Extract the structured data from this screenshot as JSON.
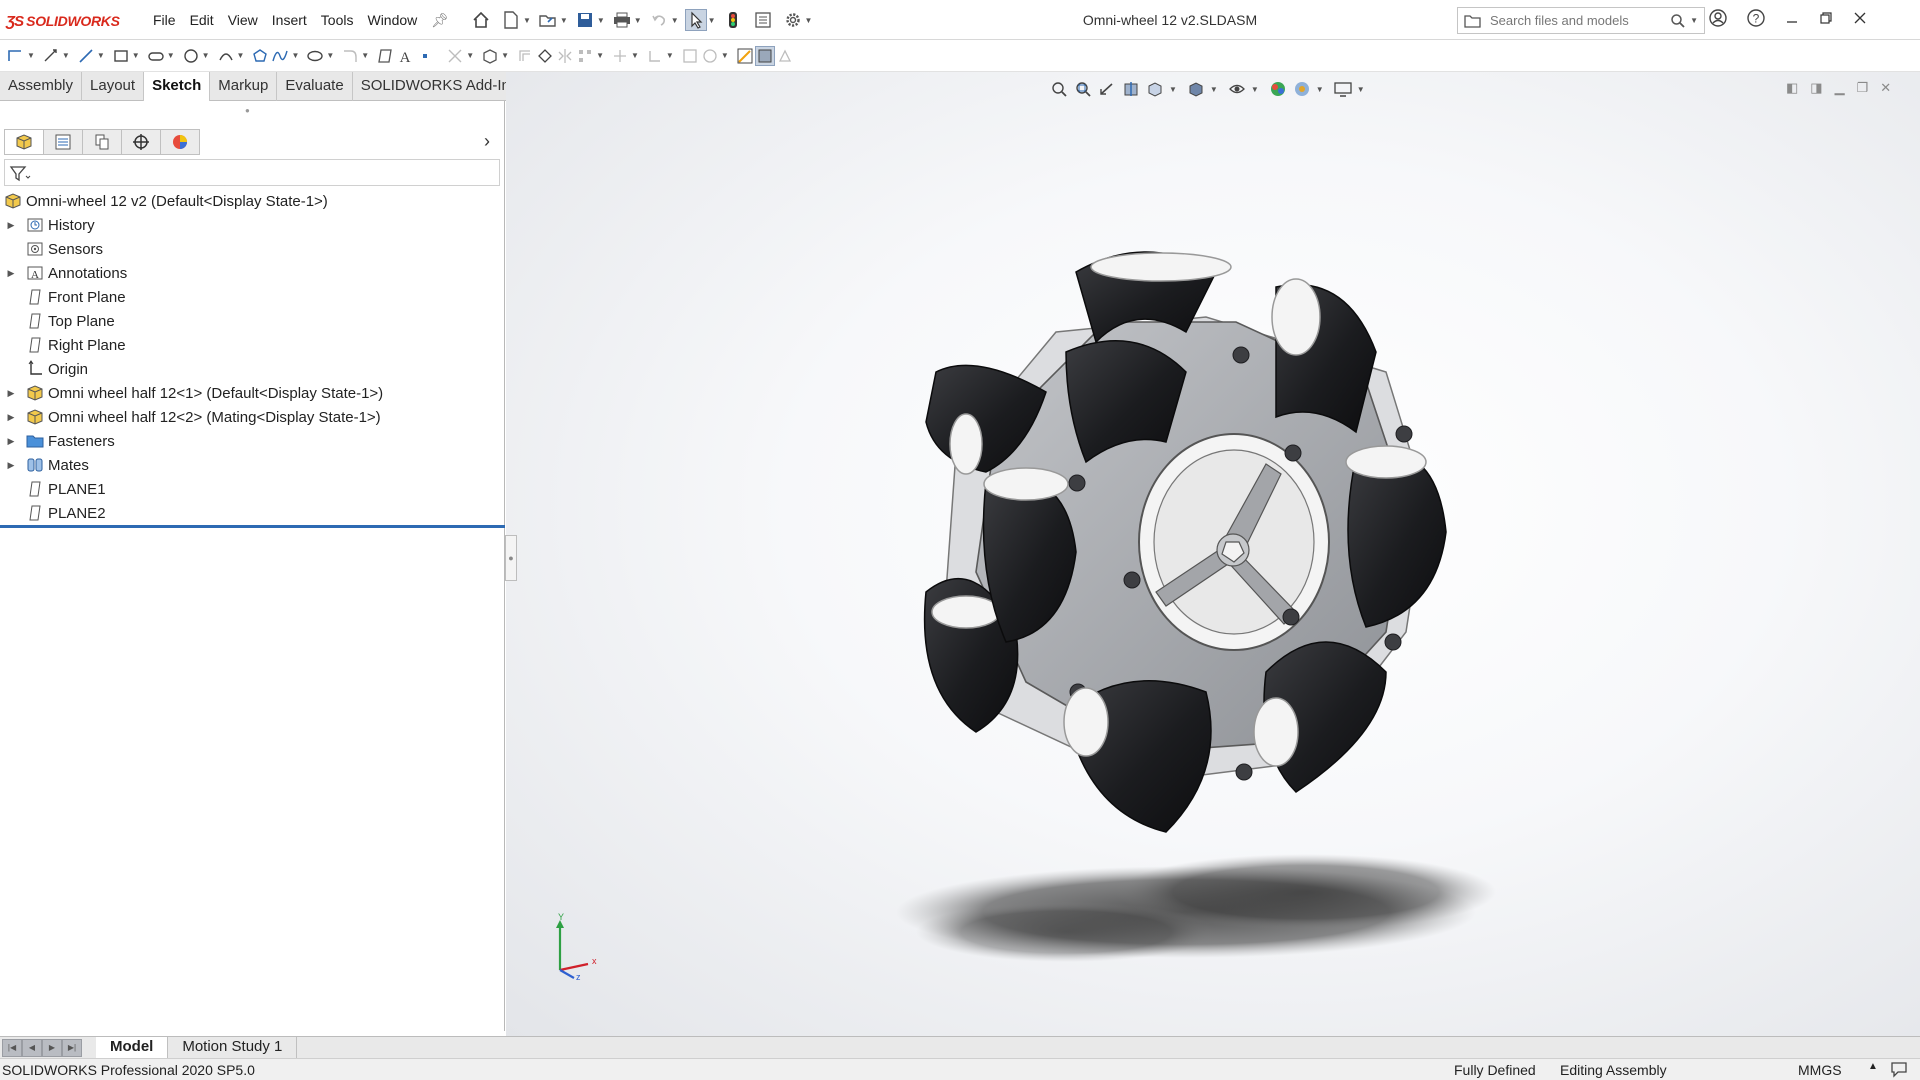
{
  "app": {
    "logo_ds": "ƷS",
    "logo_text": "SOLIDWORKS",
    "document_title": "Omni-wheel 12 v2.SLDASM"
  },
  "menu": [
    "File",
    "Edit",
    "View",
    "Insert",
    "Tools",
    "Window"
  ],
  "search": {
    "placeholder": "Search files and models"
  },
  "command_tabs": [
    {
      "label": "Assembly",
      "active": false
    },
    {
      "label": "Layout",
      "active": false
    },
    {
      "label": "Sketch",
      "active": true
    },
    {
      "label": "Markup",
      "active": false
    },
    {
      "label": "Evaluate",
      "active": false
    },
    {
      "label": "SOLIDWORKS Add-Ins",
      "active": false
    }
  ],
  "feature_tree": {
    "root": "Omni-wheel 12 v2  (Default<Display State-1>)",
    "items": [
      {
        "label": "History",
        "expandable": true,
        "icon": "history-icon"
      },
      {
        "label": "Sensors",
        "expandable": false,
        "icon": "sensor-icon"
      },
      {
        "label": "Annotations",
        "expandable": true,
        "icon": "annotation-icon"
      },
      {
        "label": "Front Plane",
        "expandable": false,
        "icon": "plane-icon"
      },
      {
        "label": "Top Plane",
        "expandable": false,
        "icon": "plane-icon"
      },
      {
        "label": "Right Plane",
        "expandable": false,
        "icon": "plane-icon"
      },
      {
        "label": "Origin",
        "expandable": false,
        "icon": "origin-icon"
      },
      {
        "label": "Omni wheel half 12<1> (Default<Display State-1>)",
        "expandable": true,
        "icon": "part-icon"
      },
      {
        "label": "Omni wheel half 12<2> (Mating<Display State-1>)",
        "expandable": true,
        "icon": "part-icon"
      },
      {
        "label": "Fasteners",
        "expandable": true,
        "icon": "folder-icon"
      },
      {
        "label": "Mates",
        "expandable": true,
        "icon": "mates-icon"
      },
      {
        "label": "PLANE1",
        "expandable": false,
        "icon": "plane-icon"
      },
      {
        "label": "PLANE2",
        "expandable": false,
        "icon": "plane-icon"
      }
    ]
  },
  "triad": {
    "x": "x",
    "y": "Y",
    "z": "z"
  },
  "bottom_tabs": [
    {
      "label": "Model",
      "active": true
    },
    {
      "label": "Motion Study 1",
      "active": false
    }
  ],
  "status": {
    "product": "SOLIDWORKS Professional 2020 SP5.0",
    "definition": "Fully Defined",
    "mode": "Editing Assembly",
    "units": "MMGS"
  },
  "colors": {
    "accent_red": "#d9291c",
    "selection_blue": "#2d6ab3",
    "roller_black": "#1c1c1e",
    "hub_gray": "#a8aaae"
  }
}
